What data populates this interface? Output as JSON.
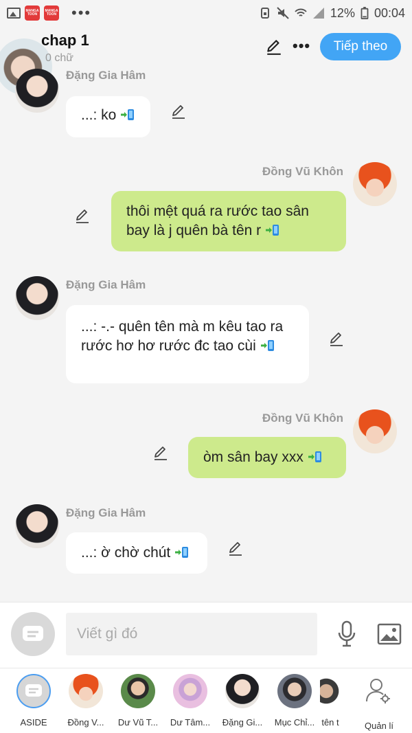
{
  "status_bar": {
    "app_badge_1": "MANGA TOON",
    "app_badge_2": "MANGA TOON",
    "battery": "12%",
    "time": "00:04"
  },
  "header": {
    "title": "chap 1",
    "subtitle": "0 chữ",
    "next_button": "Tiếp theo"
  },
  "messages": [
    {
      "sender": "Đặng Gia Hâm",
      "side": "left",
      "text": "...: ko"
    },
    {
      "sender": "Đồng Vũ Khôn",
      "side": "right",
      "text": "thôi mệt quá ra rước tao sân bay là j quên bà tên r"
    },
    {
      "sender": "Đặng Gia Hâm",
      "side": "left",
      "text": "...: -.- quên tên mà m kêu tao ra rước hơ hơ rước đc tao cùi"
    },
    {
      "sender": "Đồng Vũ Khôn",
      "side": "right",
      "text": "òm sân bay xxx"
    },
    {
      "sender": "Đặng Gia Hâm",
      "side": "left",
      "text": "...: ờ chờ chút"
    }
  ],
  "input": {
    "placeholder": "Viết gì đó"
  },
  "characters": [
    {
      "label": "ASIDE"
    },
    {
      "label": "Đồng V..."
    },
    {
      "label": "Dư Vũ T..."
    },
    {
      "label": "Dư Tâm..."
    },
    {
      "label": "Đặng Gi..."
    },
    {
      "label": "Mục Chỉ..."
    },
    {
      "label": "tên t"
    },
    {
      "label": "Quản lí"
    }
  ],
  "colors": {
    "accent": "#42a5f5",
    "bubble_right": "#cdea8c",
    "bubble_left": "#ffffff",
    "background": "#f4f4f4"
  }
}
